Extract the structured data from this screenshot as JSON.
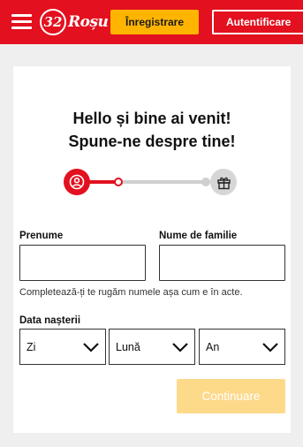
{
  "header": {
    "logo_number": "32",
    "logo_text": "Roșu",
    "register_label": "Înregistrare",
    "login_label": "Autentificare"
  },
  "card": {
    "heading_line1": "Hello și bine ai venit!",
    "heading_line2": "Spune-ne despre tine!",
    "progress": {
      "current_step": 1,
      "total_steps": 2
    },
    "first_name": {
      "label": "Prenume",
      "value": ""
    },
    "last_name": {
      "label": "Nume de familie",
      "value": ""
    },
    "hint": "Completează-ți te rugăm numele așa cum e în acte.",
    "birth_date": {
      "label": "Data nașterii",
      "day": "Zi",
      "month": "Lună",
      "year": "An"
    },
    "continue_label": "Continuare"
  },
  "colors": {
    "brand_red": "#e3101f",
    "accent_yellow": "#ffb400",
    "disabled_button": "#fdd98a"
  }
}
